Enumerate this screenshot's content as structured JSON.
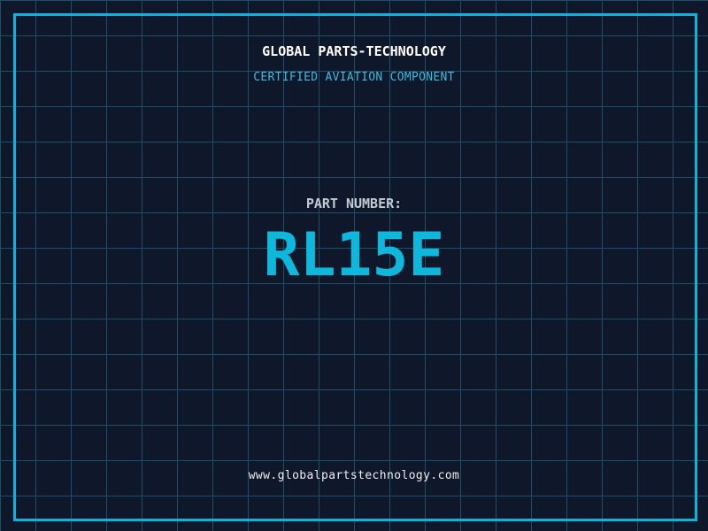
{
  "colors": {
    "background": "#0f172a",
    "grid": "#1d4f66",
    "frame": "#0bb4da",
    "title": "#ffffff",
    "certification": "#38bde0",
    "part_label": "#c2cad2",
    "part_number": "#0db8dc",
    "footer": "#eeeeee"
  },
  "header": {
    "company": "GLOBAL PARTS-TECHNOLOGY",
    "certification": "CERTIFIED AVIATION COMPONENT"
  },
  "part": {
    "label": "PART NUMBER:",
    "number": "RL15E"
  },
  "footer": {
    "website": "www.globalpartstechnology.com"
  }
}
